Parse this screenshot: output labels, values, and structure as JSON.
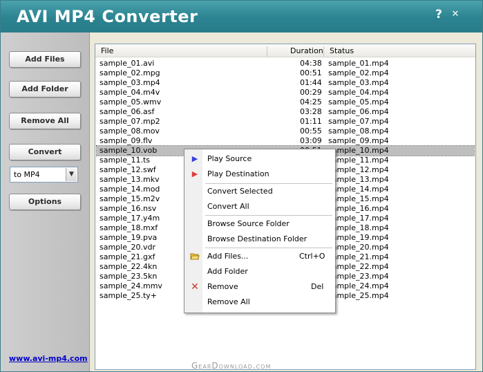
{
  "app": {
    "title": "AVI MP4 Converter",
    "help": "?",
    "close": "✕"
  },
  "sidebar": {
    "add_files": "Add Files",
    "add_folder": "Add Folder",
    "remove_all": "Remove All",
    "convert": "Convert",
    "format_selected": "to MP4",
    "options": "Options",
    "website": "www.avi-mp4.com"
  },
  "list": {
    "columns": {
      "file": "File",
      "duration": "Duration",
      "status": "Status"
    },
    "rows": [
      {
        "file": "sample_01.avi",
        "duration": "04:38",
        "status": "sample_01.mp4"
      },
      {
        "file": "sample_02.mpg",
        "duration": "00:51",
        "status": "sample_02.mp4"
      },
      {
        "file": "sample_03.mp4",
        "duration": "01:44",
        "status": "sample_03.mp4"
      },
      {
        "file": "sample_04.m4v",
        "duration": "00:29",
        "status": "sample_04.mp4"
      },
      {
        "file": "sample_05.wmv",
        "duration": "04:25",
        "status": "sample_05.mp4"
      },
      {
        "file": "sample_06.asf",
        "duration": "03:28",
        "status": "sample_06.mp4"
      },
      {
        "file": "sample_07.mp2",
        "duration": "01:11",
        "status": "sample_07.mp4"
      },
      {
        "file": "sample_08.mov",
        "duration": "00:55",
        "status": "sample_08.mp4"
      },
      {
        "file": "sample_09.flv",
        "duration": "03:09",
        "status": "sample_09.mp4"
      },
      {
        "file": "sample_10.vob",
        "duration": "00:51",
        "status": "sample_10.mp4"
      },
      {
        "file": "sample_11.ts",
        "duration": "",
        "status": "sample_11.mp4"
      },
      {
        "file": "sample_12.swf",
        "duration": "",
        "status": "sample_12.mp4"
      },
      {
        "file": "sample_13.mkv",
        "duration": "",
        "status": "sample_13.mp4"
      },
      {
        "file": "sample_14.mod",
        "duration": "",
        "status": "sample_14.mp4"
      },
      {
        "file": "sample_15.m2v",
        "duration": "",
        "status": "sample_15.mp4"
      },
      {
        "file": "sample_16.nsv",
        "duration": "",
        "status": "sample_16.mp4"
      },
      {
        "file": "sample_17.y4m",
        "duration": "",
        "status": "sample_17.mp4"
      },
      {
        "file": "sample_18.mxf",
        "duration": "",
        "status": "sample_18.mp4"
      },
      {
        "file": "sample_19.pva",
        "duration": "",
        "status": "sample_19.mp4"
      },
      {
        "file": "sample_20.vdr",
        "duration": "",
        "status": "sample_20.mp4"
      },
      {
        "file": "sample_21.gxf",
        "duration": "",
        "status": "sample_21.mp4"
      },
      {
        "file": "sample_22.4kn",
        "duration": "",
        "status": "sample_22.mp4"
      },
      {
        "file": "sample_23.5kn",
        "duration": "",
        "status": "sample_23.mp4"
      },
      {
        "file": "sample_24.mmv",
        "duration": "",
        "status": "sample_24.mp4"
      },
      {
        "file": "sample_25.ty+",
        "duration": "",
        "status": "sample_25.mp4"
      }
    ]
  },
  "context_menu": {
    "play_source": "Play Source",
    "play_destination": "Play Destination",
    "convert_selected": "Convert Selected",
    "convert_all": "Convert All",
    "browse_source": "Browse Source Folder",
    "browse_destination": "Browse Destination Folder",
    "add_files": "Add Files...",
    "add_files_key": "Ctrl+O",
    "add_folder": "Add Folder",
    "remove": "Remove",
    "remove_key": "Del",
    "remove_all": "Remove All"
  },
  "watermark": "GearDownload.com",
  "colors": {
    "accent": "#2b8391",
    "link": "#0000cc",
    "selection": "#bebebe"
  }
}
